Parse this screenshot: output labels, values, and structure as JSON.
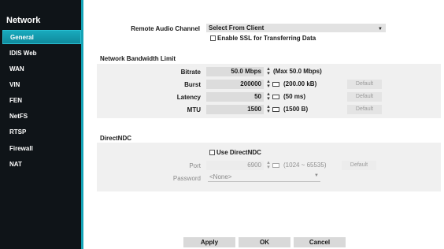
{
  "sidebar": {
    "title": "Network",
    "items": [
      {
        "label": "General",
        "active": true
      },
      {
        "label": "IDIS Web"
      },
      {
        "label": "WAN"
      },
      {
        "label": "VIN"
      },
      {
        "label": "FEN"
      },
      {
        "label": "NetFS"
      },
      {
        "label": "RTSP"
      },
      {
        "label": "Firewall"
      },
      {
        "label": "NAT"
      }
    ]
  },
  "audio": {
    "label": "Remote Audio Channel",
    "value": "Select From Client",
    "ssl_label": "Enable SSL for Transferring Data"
  },
  "bandwidth": {
    "title": "Network Bandwidth Limit",
    "bitrate": {
      "label": "Bitrate",
      "value": "50.0 Mbps",
      "note": "(Max 50.0 Mbps)"
    },
    "burst": {
      "label": "Burst",
      "value": "200000",
      "note": "(200.00 kB)",
      "default": "Default"
    },
    "latency": {
      "label": "Latency",
      "value": "50",
      "note": "(50 ms)",
      "default": "Default"
    },
    "mtu": {
      "label": "MTU",
      "value": "1500",
      "note": "(1500 B)",
      "default": "Default"
    }
  },
  "directndc": {
    "title": "DirectNDC",
    "use_label": "Use DirectNDC",
    "port": {
      "label": "Port",
      "value": "6900",
      "note": "(1024 ~ 65535)",
      "default": "Default"
    },
    "password": {
      "label": "Password",
      "value": "<None>"
    }
  },
  "footer": {
    "apply": "Apply",
    "ok": "OK",
    "cancel": "Cancel"
  },
  "colors": {
    "accent": "#14a3b6",
    "sidebar_bg": "#0f1418"
  }
}
